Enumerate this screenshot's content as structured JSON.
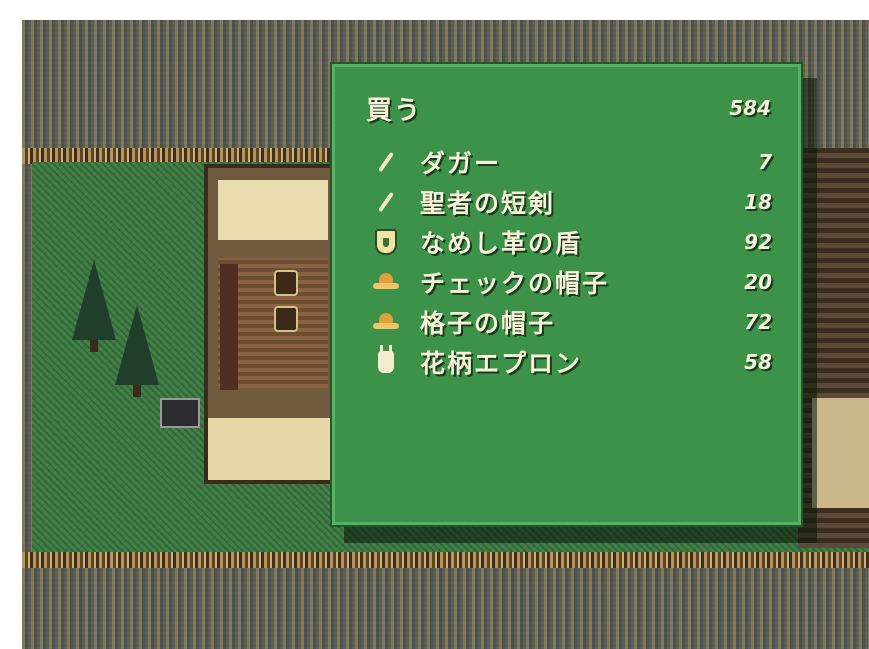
{
  "shop": {
    "title": "買う",
    "gold": "584",
    "items": [
      {
        "icon": "dagger-icon",
        "name": "ダガー",
        "price": "7"
      },
      {
        "icon": "short-sword-icon",
        "name": "聖者の短剣",
        "price": "18"
      },
      {
        "icon": "shield-icon",
        "name": "なめし革の盾",
        "price": "92"
      },
      {
        "icon": "hat-icon",
        "name": "チェックの帽子",
        "price": "20"
      },
      {
        "icon": "hat-icon",
        "name": "格子の帽子",
        "price": "72"
      },
      {
        "icon": "apron-icon",
        "name": "花柄エプロン",
        "price": "58"
      }
    ]
  },
  "colors": {
    "window_bg": "#3c9248",
    "window_border": "#1e5a28",
    "text": "#f6f1d8",
    "grass": "#3f7d45"
  }
}
